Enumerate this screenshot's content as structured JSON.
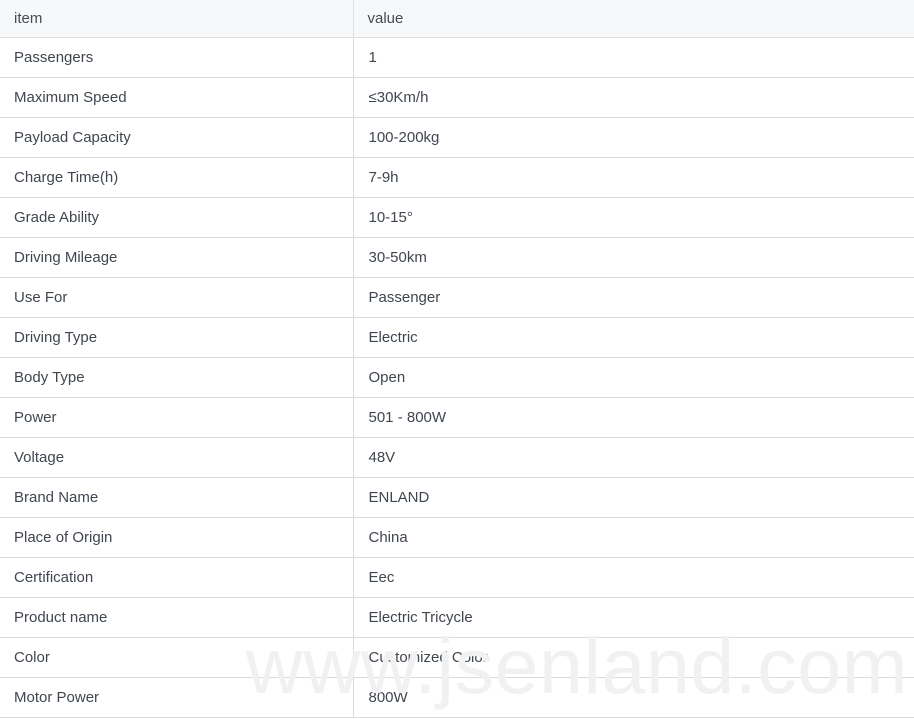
{
  "table": {
    "columns": [
      {
        "key": "item",
        "label": "item"
      },
      {
        "key": "value",
        "label": "value"
      }
    ],
    "rows": [
      {
        "item": "Passengers",
        "value": "1"
      },
      {
        "item": "Maximum Speed",
        "value": "≤30Km/h"
      },
      {
        "item": "Payload Capacity",
        "value": "100-200kg"
      },
      {
        "item": "Charge Time(h)",
        "value": "7-9h"
      },
      {
        "item": "Grade Ability",
        "value": "10-15°"
      },
      {
        "item": "Driving Mileage",
        "value": "30-50km"
      },
      {
        "item": "Use For",
        "value": "Passenger"
      },
      {
        "item": "Driving Type",
        "value": "Electric"
      },
      {
        "item": "Body Type",
        "value": "Open"
      },
      {
        "item": "Power",
        "value": "501 - 800W"
      },
      {
        "item": "Voltage",
        "value": "48V"
      },
      {
        "item": "Brand Name",
        "value": "ENLAND"
      },
      {
        "item": "Place of Origin",
        "value": "China"
      },
      {
        "item": "Certification",
        "value": "Eec"
      },
      {
        "item": "Product name",
        "value": "Electric Tricycle"
      },
      {
        "item": "Color",
        "value": "Customized Color"
      },
      {
        "item": "Motor Power",
        "value": "800W"
      }
    ]
  },
  "watermark": {
    "text": "www.jsenland.com",
    "color": "#f1f1f1"
  },
  "style": {
    "header_background": "#f7f8f9",
    "border_color": "#d9dbdd",
    "text_color": "#40464f"
  }
}
